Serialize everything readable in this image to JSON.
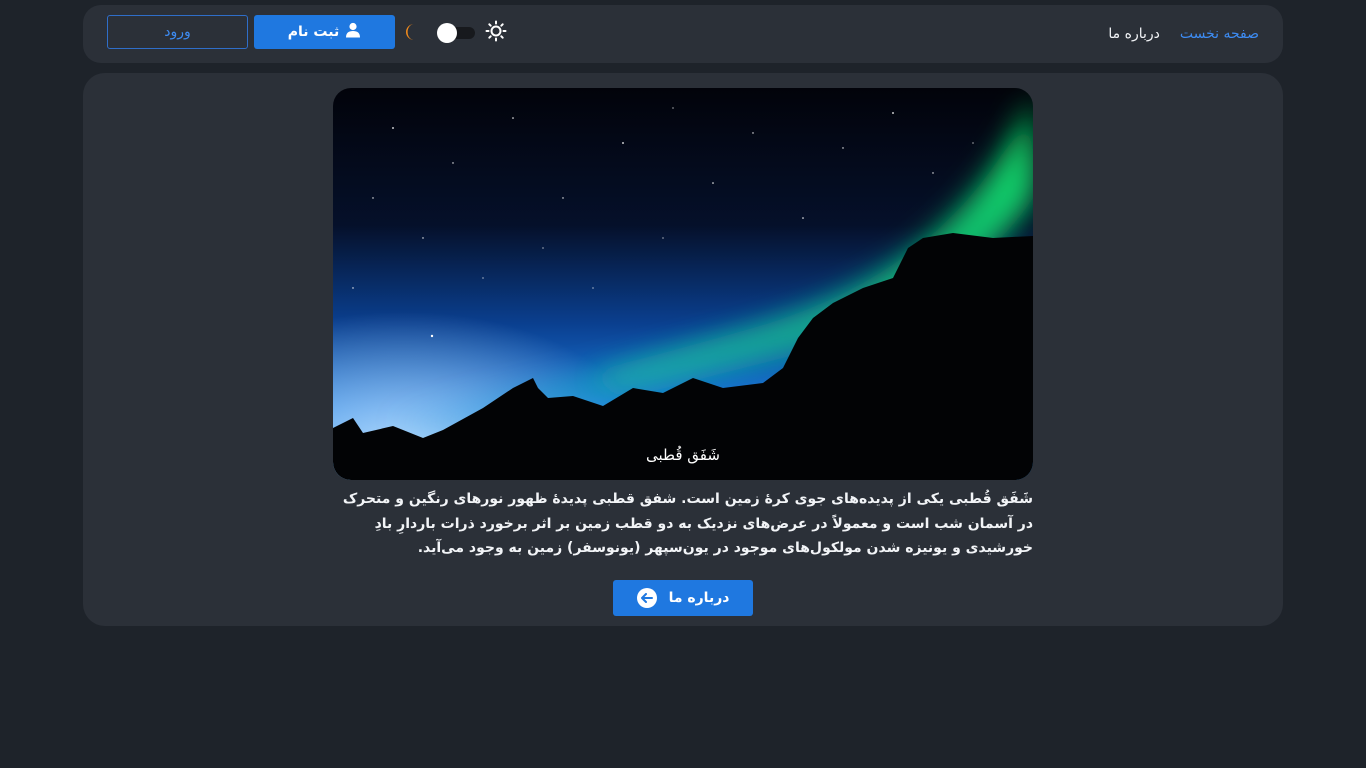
{
  "nav": {
    "home_label": "صفحه نخست",
    "about_label": "درباره ما",
    "signup_label": "ثبت نام",
    "login_label": "ورود",
    "signup_icon": "user-icon",
    "theme_icons": [
      "moon-icon",
      "sun-icon"
    ],
    "theme_toggle_state": "off"
  },
  "hero": {
    "caption": "شَفَق قُطبی"
  },
  "description": "شَفَق قُطبی یکی از پدیده‌های جوی کرهٔ زمین است. شفق قطبی پدیدهٔ ظهور نورهای رنگین و متحرک در آسمان شب است و معمولاً در عرض‌های نزدیک به دو قطب زمین بر اثر برخورد ذرات باردارِ بادِ خورشیدی و یونیزه شدن مولکول‌های موجود در یون‌سپهر (یونوسفر) زمین به وجود می‌آید.",
  "about_button": {
    "label": "درباره ما",
    "icon": "arrow-circle-icon"
  },
  "colors": {
    "page_bg": "#1e232a",
    "card_bg": "#2b3038",
    "accent": "#1f78e0",
    "link": "#3d8bf2",
    "moon": "#f08a1c"
  }
}
